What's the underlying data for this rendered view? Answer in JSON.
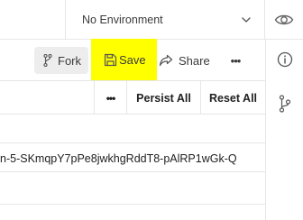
{
  "environment": {
    "selected_label": "No Environment",
    "chevron_icon": "chevron-down-icon",
    "visibility_icon": "eye-icon"
  },
  "toolbar": {
    "fork_label": "Fork",
    "save_label": "Save",
    "share_label": "Share",
    "more_label": "•••",
    "save_highlight_color": "#ffff00"
  },
  "variables_header": {
    "more_label": "•••",
    "persist_all_label": "Persist All",
    "reset_all_label": "Reset All"
  },
  "rows": [
    {
      "value": ""
    },
    {
      "value": "n-5-SKmqpY7pPe8jwkhgRddT8-pAlRP1wGk-Q"
    },
    {
      "value": ""
    }
  ],
  "right_rail": {
    "info_icon": "info-icon",
    "fork_icon": "fork-icon"
  }
}
